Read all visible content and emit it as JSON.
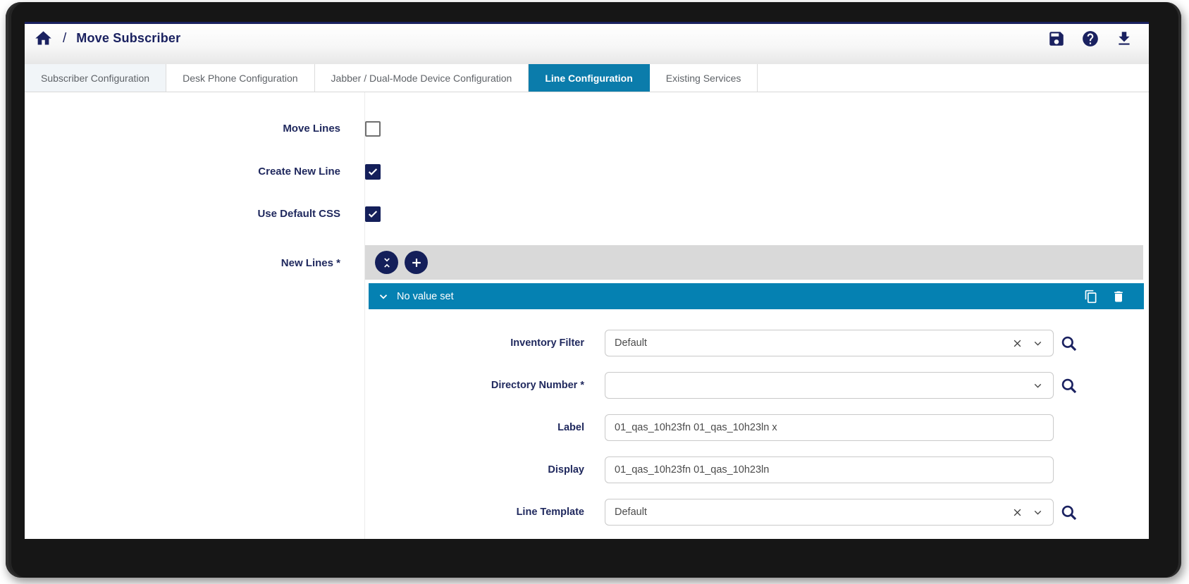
{
  "header": {
    "breadcrumb": {
      "separator": "/",
      "title": "Move Subscriber"
    },
    "actions": [
      {
        "name": "save"
      },
      {
        "name": "help"
      },
      {
        "name": "download"
      }
    ]
  },
  "tabs": [
    {
      "label": "Subscriber Configuration",
      "active": false
    },
    {
      "label": "Desk Phone Configuration",
      "active": false
    },
    {
      "label": "Jabber / Dual-Mode Device Configuration",
      "active": false
    },
    {
      "label": "Line Configuration",
      "active": true
    },
    {
      "label": "Existing Services",
      "active": false
    }
  ],
  "form": {
    "checkboxes": [
      {
        "label": "Move Lines",
        "checked": false
      },
      {
        "label": "Create New Line",
        "checked": true
      },
      {
        "label": "Use Default CSS",
        "checked": true
      }
    ],
    "new_lines": {
      "label": "New Lines *",
      "toolbar_icons": [
        "collapse",
        "add"
      ],
      "group_header": "No value set",
      "fields": [
        {
          "label": "Inventory Filter",
          "value": "Default"
        },
        {
          "label": "Directory Number *",
          "value": ""
        },
        {
          "label": "Label",
          "value": "01_qas_10h23fn 01_qas_10h23ln x"
        },
        {
          "label": "Display",
          "value": "01_qas_10h23fn 01_qas_10h23ln"
        },
        {
          "label": "Line Template",
          "value": "Default"
        }
      ]
    }
  },
  "colors": {
    "navy": "#1a2160",
    "active_tab_blue": "#0b7cab",
    "group_header_blue": "#0581b2",
    "toolbar_gray": "#d9d9d9",
    "tab_text_gray": "#5f6368"
  }
}
